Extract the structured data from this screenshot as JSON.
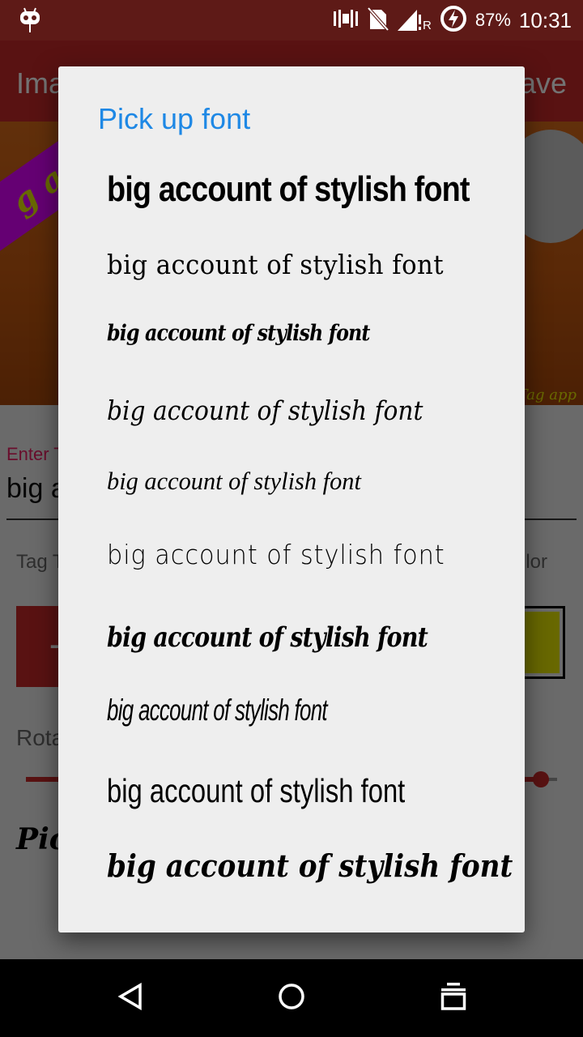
{
  "status_bar": {
    "notification_icon": "cyanogenmod-bot-icon",
    "icons": [
      "vibrate-icon",
      "no-sim-icon",
      "signal-roaming-icon",
      "battery-charging-icon"
    ],
    "roaming_label": "R",
    "battery_percent": "87%",
    "time": "10:31"
  },
  "app_bar": {
    "title": "Ima",
    "action_label": "ave"
  },
  "background_screen": {
    "preview_ribbon_text": "g acc",
    "preview_watermark": "Tag app",
    "text_field_label": "Enter T",
    "text_field_value": "big a",
    "tag_label": "Tag T",
    "color_label": "lor",
    "add_button_label": "+",
    "rotate_label": "Rota",
    "rotate_value_fraction": 0.97,
    "pick_font_label": "Pic",
    "colors": {
      "primary": "#c62828",
      "accent_field_label": "#e91e63",
      "ribbon": "#e000ff",
      "text_color_swatch": "#e6e600"
    }
  },
  "dialog": {
    "title": "Pick up font",
    "title_color": "#1e88e5",
    "font_options": [
      {
        "label": "big account of stylish font",
        "style": "condensed-bold"
      },
      {
        "label": "big account of stylish font",
        "style": "serif-classic"
      },
      {
        "label": "big account of stylish font",
        "style": "script-bold-small"
      },
      {
        "label": "big account of stylish font",
        "style": "script-calligraphy"
      },
      {
        "label": "big account of stylish font",
        "style": "script-thin"
      },
      {
        "label": "big account of stylish font",
        "style": "handwritten"
      },
      {
        "label": "big account of stylish font",
        "style": "script-heavy"
      },
      {
        "label": "big account of stylish font",
        "style": "condensed-light-italic"
      },
      {
        "label": "big account of stylish font",
        "style": "condensed-regular"
      },
      {
        "label": "big account of stylish font",
        "style": "brush-script"
      }
    ]
  },
  "nav_bar": {
    "back": "back-icon",
    "home": "home-icon",
    "recents": "recents-icon"
  }
}
